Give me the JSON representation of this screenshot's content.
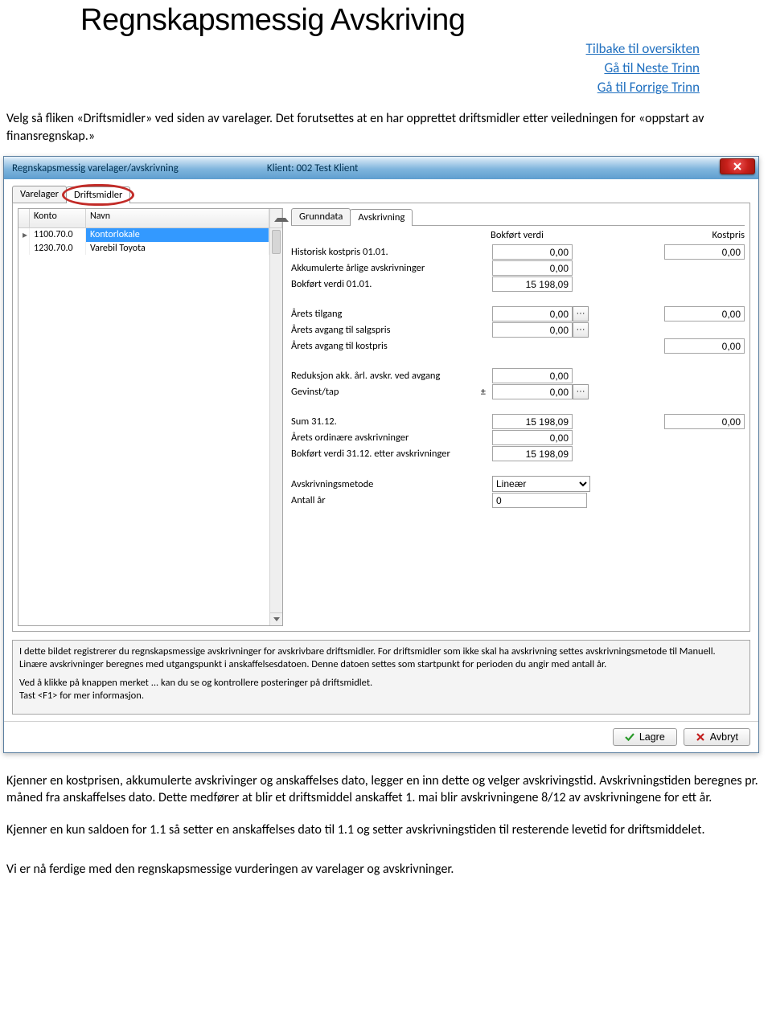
{
  "doc": {
    "heading": "Regnskapsmessig Avskriving",
    "nav": {
      "overview": "Tilbake til oversikten",
      "next": "Gå til Neste Trinn",
      "prev": "Gå til Forrige Trinn"
    },
    "para1": "Velg så fliken «Driftsmidler» ved siden av varelager. Det forutsettes at en har opprettet driftsmidler etter veiledningen for «oppstart av finansregnskap.»",
    "para2": "Kjenner en kostprisen, akkumulerte avskrivinger og anskaffelses dato, legger en inn dette og velger avskrivingstid. Avskrivningstiden beregnes pr. måned fra anskaffelses dato. Dette medfører at blir et driftsmiddel anskaffet 1. mai blir avskrivningene 8/12 av avskrivningene for ett år.",
    "para3": "Kjenner en kun saldoen for 1.1 så setter en anskaffelses dato til 1.1 og setter avskrivningstiden til resterende levetid for driftsmiddelet.",
    "para4": "Vi er nå ferdige med den regnskapsmessige vurderingen av varelager og avskrivninger."
  },
  "dialog": {
    "title": "Regnskapsmessig varelager/avskrivning",
    "client": "Klient: 002 Test Klient",
    "tabs": {
      "varelager": "Varelager",
      "driftsmidler": "Driftsmidler"
    },
    "listview": {
      "headers": {
        "konto": "Konto",
        "navn": "Navn"
      },
      "rows": [
        {
          "konto": "1100.70.0",
          "navn": "Kontorlokale",
          "selected": true,
          "current": true
        },
        {
          "konto": "1230.70.0",
          "navn": "Varebil Toyota"
        }
      ]
    },
    "subtabs": {
      "grunndata": "Grunndata",
      "avskrivning": "Avskrivning"
    },
    "headers": {
      "bokfort": "Bokført verdi",
      "kostpris": "Kostpris"
    },
    "fields": {
      "hist_label": "Historisk kostpris 01.01.",
      "hist_val": "0,00",
      "hist_kost": "0,00",
      "akk_label": "Akkumulerte årlige avskrivninger",
      "akk_val": "0,00",
      "bok01_label": "Bokført verdi 01.01.",
      "bok01_val": "15 198,09",
      "tilgang_label": "Årets tilgang",
      "tilgang_val": "0,00",
      "tilgang_side": "0,00",
      "avg_salg_label": "Årets avgang til salgspris",
      "avg_salg_val": "0,00",
      "avg_kost_label": "Årets avgang til kostpris",
      "avg_kost_side": "0,00",
      "red_label": "Reduksjon akk. årl. avskr. ved avgang",
      "red_val": "0,00",
      "gevinst_label": "Gevinst/tap",
      "gevinst_sym": "±",
      "gevinst_val": "0,00",
      "sum_label": "Sum 31.12.",
      "sum_val": "15 198,09",
      "sum_side": "0,00",
      "ord_label": "Årets ordinære avskrivninger",
      "ord_val": "0,00",
      "bok31_label": "Bokført verdi 31.12. etter avskrivninger",
      "bok31_val": "15 198,09",
      "metode_label": "Avskrivningsmetode",
      "metode_val": "Lineær",
      "antall_label": "Antall år",
      "antall_val": "0"
    },
    "ellipsis": "···",
    "help": {
      "p1": "I dette bildet registrerer du regnskapsmessige avskrivninger for avskrivbare driftsmidler. For driftsmidler som ikke skal ha avskrivning settes avskrivningsmetode til Manuell. Linære avskrivninger beregnes med utgangspunkt i anskaffelsesdatoen. Denne datoen settes som startpunkt for perioden du angir med antall år.",
      "p2": "Ved å klikke på knappen merket ... kan du se og kontrollere posteringer på driftsmidlet.\nTast <F1> for mer informasjon."
    },
    "buttons": {
      "lagre": "Lagre",
      "avbryt": "Avbryt"
    }
  }
}
